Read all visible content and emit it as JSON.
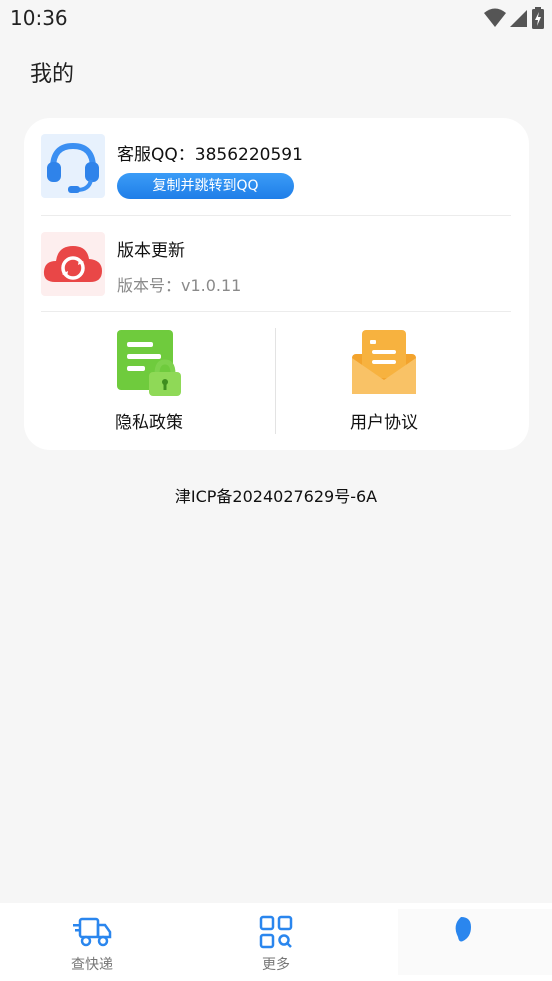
{
  "status_bar": {
    "time": "10:36",
    "icons": [
      "wifi-icon",
      "signal-icon",
      "battery-charging-icon"
    ]
  },
  "header": {
    "title": "我的"
  },
  "card": {
    "customer_service": {
      "icon": "headset-icon",
      "title": "客服QQ：3856220591",
      "button_label": "复制并跳转到QQ"
    },
    "update": {
      "icon": "cloud-refresh-icon",
      "title": "版本更新",
      "version": "版本号：v1.0.11"
    },
    "grid": [
      {
        "icon": "privacy-document-lock-icon",
        "label": "隐私政策"
      },
      {
        "icon": "user-agreement-envelope-icon",
        "label": "用户协议"
      }
    ]
  },
  "footer": {
    "icp": "津ICP备2024027629号-6A"
  },
  "tabbar": {
    "tabs": [
      {
        "icon": "delivery-truck-icon",
        "label": "查快递",
        "active": false
      },
      {
        "icon": "grid-search-icon",
        "label": "更多",
        "active": false
      },
      {
        "icon": "profile-icon",
        "label": "",
        "active": true
      }
    ]
  },
  "colors": {
    "accent_blue": "#2a86ee",
    "update_red": "#e94747",
    "privacy_green": "#6fcb3d",
    "agreement_orange": "#f3a32c",
    "background": "#f6f6f6"
  }
}
